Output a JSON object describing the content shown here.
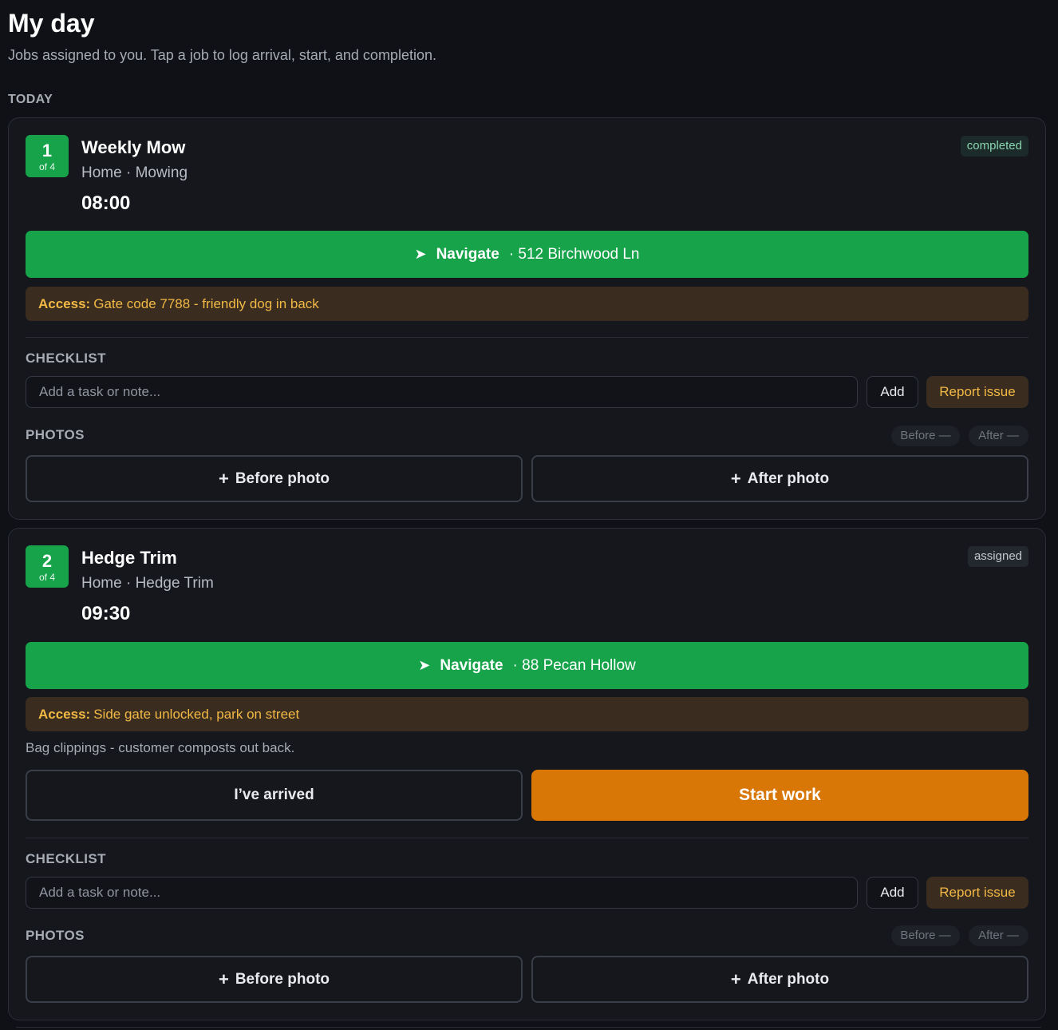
{
  "header": {
    "title": "My day",
    "subtitle": "Jobs assigned to you. Tap a job to log arrival, start, and completion.",
    "section": "TODAY"
  },
  "jobs": [
    {
      "index": "1",
      "of": "of 4",
      "title": "Weekly Mow",
      "meta": "Home · Mowing",
      "time": "08:00",
      "status": "completed",
      "navigate_label": "Navigate",
      "address": "· 512 Birchwood Ln",
      "access_key": "Access:",
      "access_text": "Gate code 7788 - friendly dog in back",
      "checklist_label": "CHECKLIST",
      "task_placeholder": "Add a task or note...",
      "add_label": "Add",
      "report_label": "Report issue",
      "photos_label": "PHOTOS",
      "before_pill": "Before —",
      "after_pill": "After —",
      "before_photo": "Before photo",
      "after_photo": "After photo"
    },
    {
      "index": "2",
      "of": "of 4",
      "title": "Hedge Trim",
      "meta": "Home · Hedge Trim",
      "time": "09:30",
      "status": "assigned",
      "navigate_label": "Navigate",
      "address": "· 88 Pecan Hollow",
      "access_key": "Access:",
      "access_text": "Side gate unlocked, park on street",
      "note": "Bag clippings - customer composts out back.",
      "arrived_label": "I’ve arrived",
      "start_label": "Start work",
      "checklist_label": "CHECKLIST",
      "task_placeholder": "Add a task or note...",
      "add_label": "Add",
      "report_label": "Report issue",
      "photos_label": "PHOTOS",
      "before_pill": "Before —",
      "after_pill": "After —",
      "before_photo": "Before photo",
      "after_photo": "After photo"
    }
  ],
  "icons": {
    "navigate": "navigate-arrow-icon",
    "plus": "plus-icon"
  },
  "colors": {
    "primary_green": "#16a34a",
    "start_orange": "#d97706",
    "access_bg": "#3a2c1f",
    "access_text": "#f2b945",
    "completed_text": "#8ad6b0"
  }
}
